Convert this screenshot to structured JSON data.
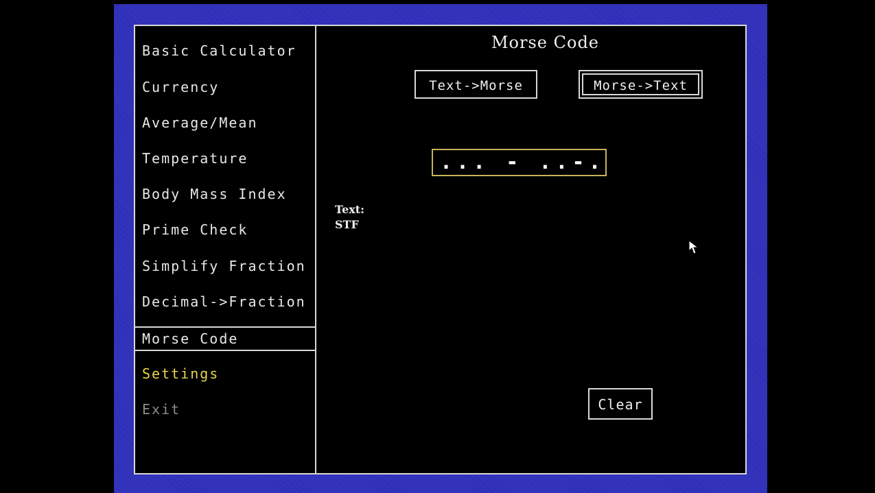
{
  "app": {
    "title": "Morse Code"
  },
  "sidebar": {
    "items": [
      {
        "label": "Basic Calculator"
      },
      {
        "label": "Currency"
      },
      {
        "label": "Average/Mean"
      },
      {
        "label": "Temperature"
      },
      {
        "label": "Body Mass Index"
      },
      {
        "label": "Prime Check"
      },
      {
        "label": "Simplify Fraction"
      },
      {
        "label": "Decimal->Fraction"
      },
      {
        "label": "Morse Code",
        "selected": true
      },
      {
        "label": "Settings",
        "color": "#e8d44d"
      },
      {
        "label": "Exit",
        "color": "#8c8c8c"
      }
    ]
  },
  "main": {
    "mode_buttons": {
      "text_to_morse": "Text->Morse",
      "morse_to_text": "Morse->Text",
      "active": "morse_to_text"
    },
    "morse_input": {
      "value": "... - ..-."
    },
    "result": {
      "label": "Text:",
      "value": "STF"
    },
    "clear_label": "Clear"
  },
  "colors": {
    "frame_blue": "#2b2bb8",
    "border": "#d8d8d8",
    "input_border": "#c8b45a",
    "settings_yellow": "#e8d44d",
    "exit_gray": "#8c8c8c"
  }
}
